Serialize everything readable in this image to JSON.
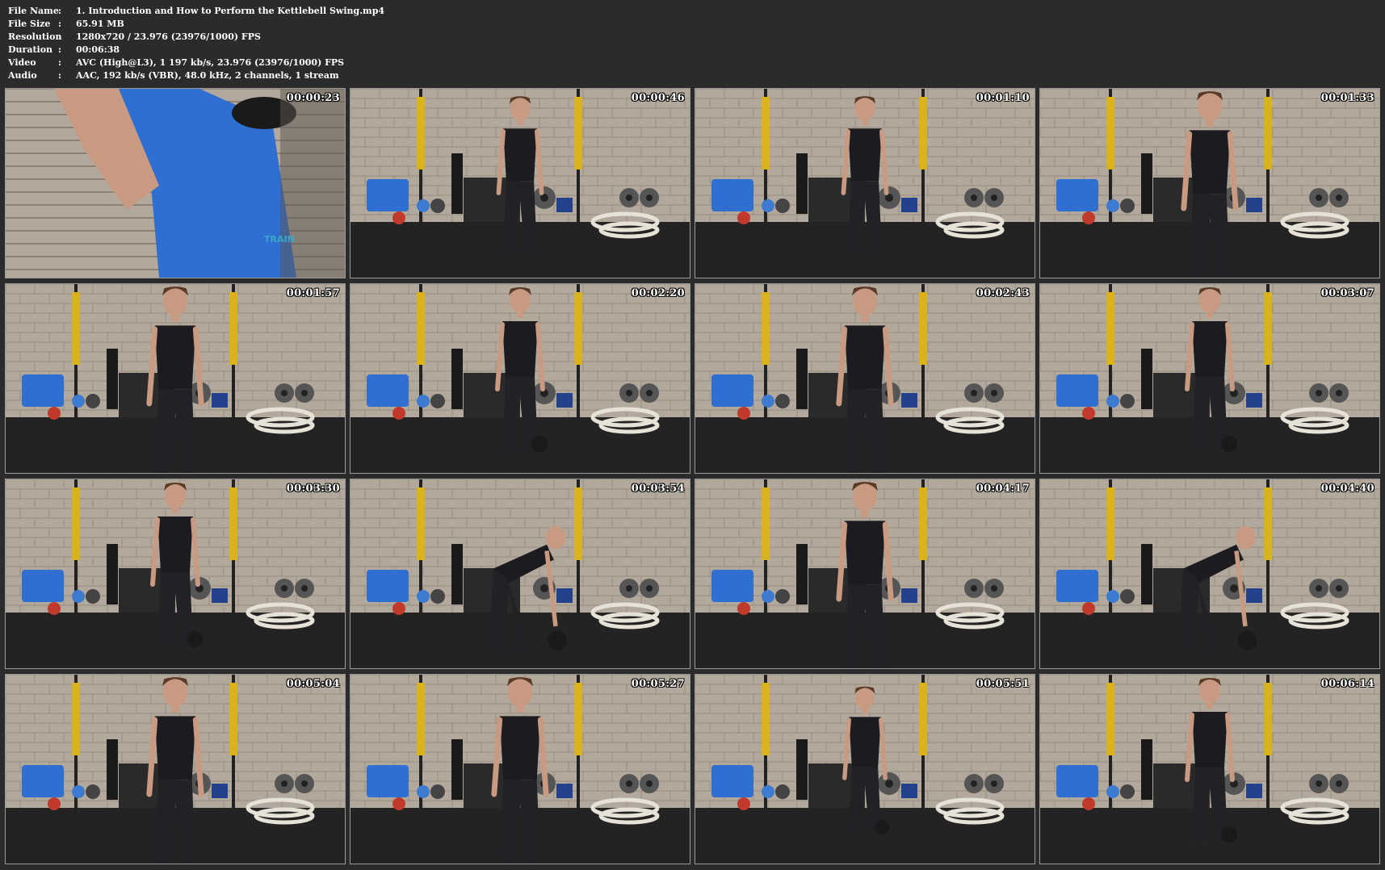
{
  "file_info": [
    {
      "label": "File Name",
      "value": "1. Introduction and How to Perform the Kettlebell Swing.mp4"
    },
    {
      "label": "File Size",
      "value": "65.91 MB"
    },
    {
      "label": "Resolution",
      "value": "1280x720 / 23.976 (23976/1000) FPS"
    },
    {
      "label": "Duration",
      "value": "00:06:38"
    },
    {
      "label": "Video",
      "value": "AVC (High@L3), 1 197 kb/s, 23.976 (23976/1000) FPS"
    },
    {
      "label": "Audio",
      "value": "AAC, 192 kb/s (VBR), 48.0 kHz, 2 channels, 1 stream"
    }
  ],
  "separator": ":",
  "thumbnails": [
    {
      "time": "00:00:23",
      "scene": "closeup"
    },
    {
      "time": "00:00:46",
      "scene": "stand"
    },
    {
      "time": "00:01:10",
      "scene": "stand"
    },
    {
      "time": "00:01:33",
      "scene": "stand-near"
    },
    {
      "time": "00:01:57",
      "scene": "stand-near"
    },
    {
      "time": "00:02:20",
      "scene": "stand-bell"
    },
    {
      "time": "00:02:43",
      "scene": "stand-near"
    },
    {
      "time": "00:03:07",
      "scene": "stand-bell"
    },
    {
      "time": "00:03:30",
      "scene": "stand-bell"
    },
    {
      "time": "00:03:54",
      "scene": "bend"
    },
    {
      "time": "00:04:17",
      "scene": "stand-near"
    },
    {
      "time": "00:04:40",
      "scene": "bend"
    },
    {
      "time": "00:05:04",
      "scene": "stand-near"
    },
    {
      "time": "00:05:27",
      "scene": "stand-near"
    },
    {
      "time": "00:05:51",
      "scene": "swing"
    },
    {
      "time": "00:06:14",
      "scene": "stand-bell"
    }
  ],
  "colors": {
    "background": "#2b2b2b",
    "brick": "#b3a89c",
    "floor": "#232323",
    "tank_top": "#1c1c20",
    "pants": "#222226",
    "accent_blue": "#2f6fd1",
    "kettlebell": "#1a1a1a",
    "rope": "#e7e2d8",
    "strap": "#d9b21c"
  }
}
